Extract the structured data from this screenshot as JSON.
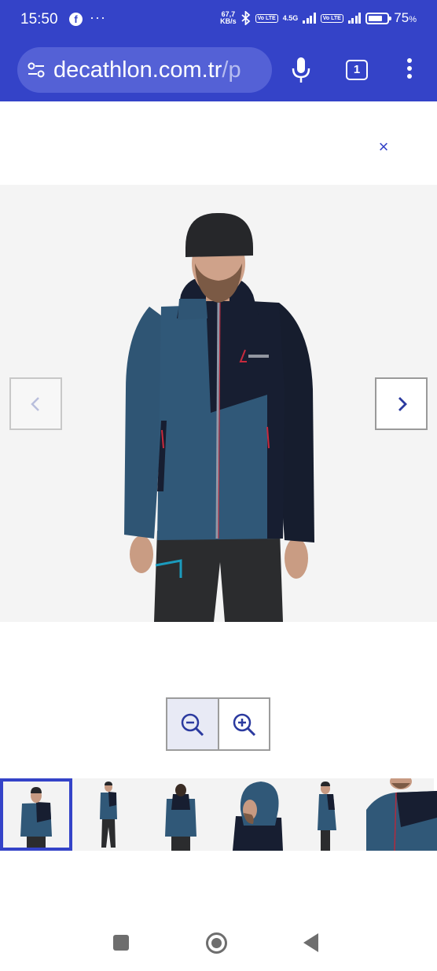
{
  "status_bar": {
    "time": "15:50",
    "notification_icons": [
      "facebook-icon",
      "more-notifications-icon"
    ],
    "net_speed_value": "67,7",
    "net_speed_unit": "KB/s",
    "volte_label": "Vo LTE",
    "network_type": "4.5G",
    "battery_percent": "75",
    "battery_unit": "%",
    "battery_level": 0.75
  },
  "browser": {
    "url_host": "decathlon.com.tr",
    "url_path_fragment": "/p",
    "tab_count": "1",
    "accent_color": "#3443c8"
  },
  "viewer": {
    "close_symbol": "×",
    "thumbnail_count": 6,
    "selected_thumbnail": 1
  }
}
